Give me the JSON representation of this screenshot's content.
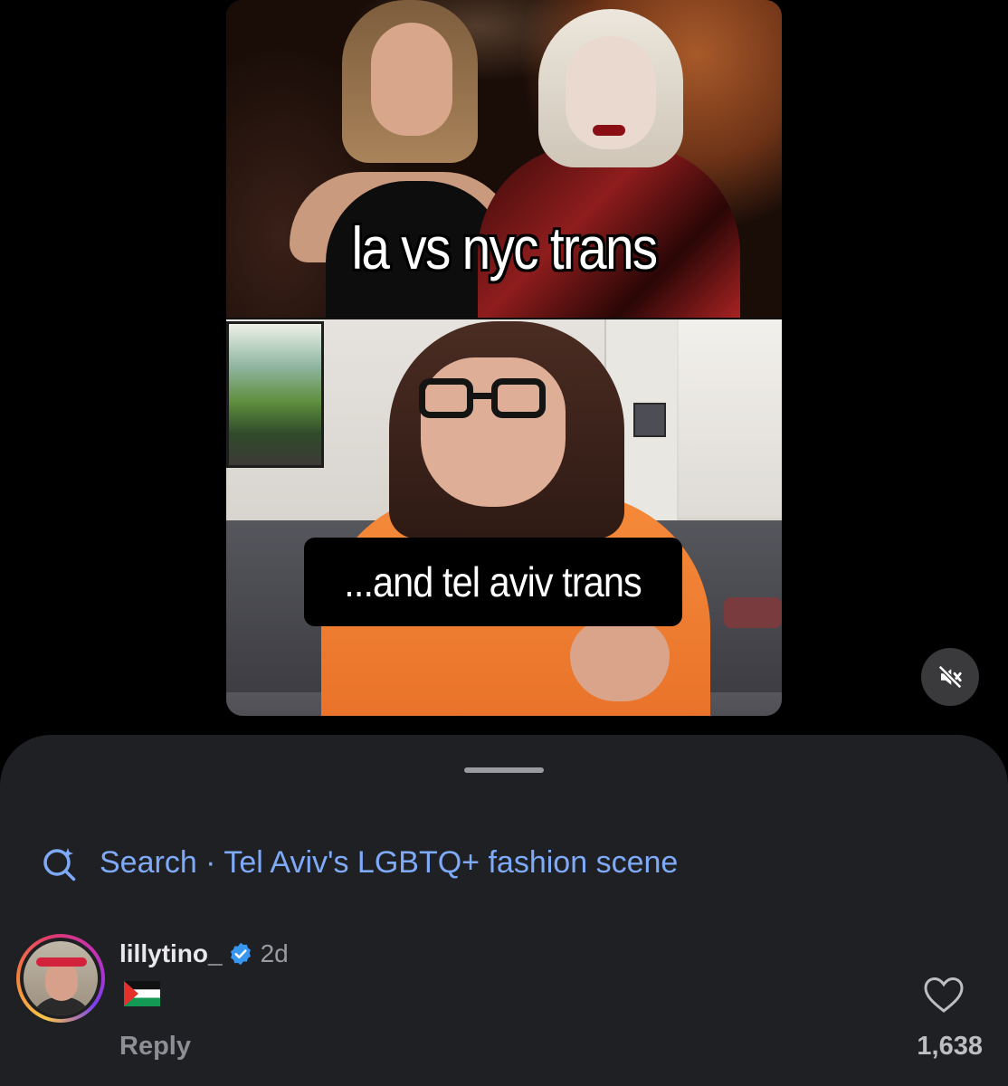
{
  "video": {
    "caption_top": "la vs nyc trans",
    "caption_bottom": "...and tel aviv trans",
    "mute_icon": "speaker-muted-icon"
  },
  "sheet": {
    "search": {
      "icon": "search-sparkle-icon",
      "prefix": "Search",
      "separator": " · ",
      "query": "Tel Aviv's LGBTQ+ fashion scene"
    },
    "comment": {
      "username": "lillytino_",
      "verified": true,
      "age": "2d",
      "body_emoji": "🇵🇸",
      "reply_label": "Reply",
      "like_count": "1,638",
      "like_icon": "heart-outline-icon"
    }
  },
  "colors": {
    "sheet_bg": "#1f2024",
    "link_blue": "#7eaaf8",
    "verified_blue": "#3797f0"
  }
}
